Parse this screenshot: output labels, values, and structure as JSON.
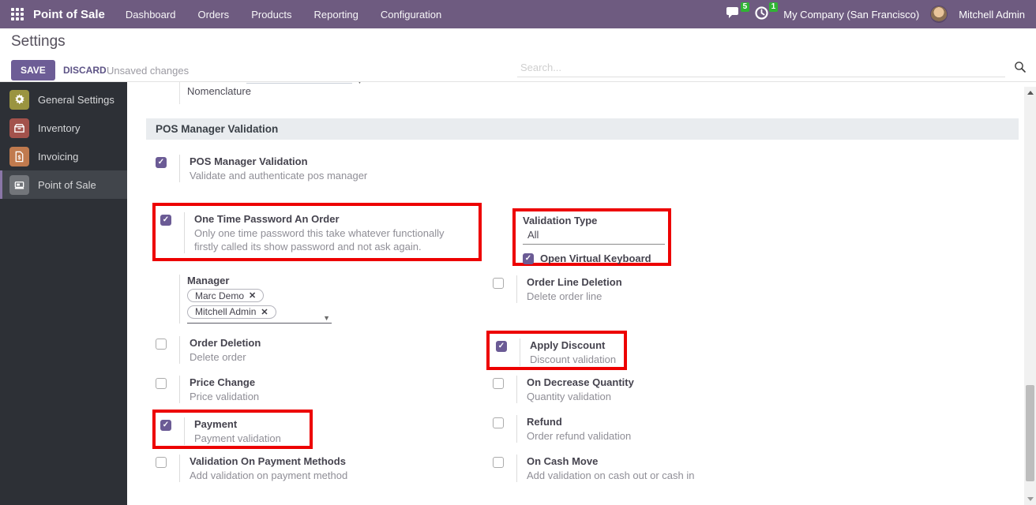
{
  "topbar": {
    "app_name": "Point of Sale",
    "menus": {
      "dashboard": "Dashboard",
      "orders": "Orders",
      "products": "Products",
      "reporting": "Reporting",
      "configuration": "Configuration"
    },
    "messages_badge": "5",
    "activities_badge": "1",
    "company": "My Company (San Francisco)",
    "user": "Mitchell Admin"
  },
  "control_panel": {
    "title": "Settings",
    "save_label": "SAVE",
    "discard_label": "DISCARD",
    "status": "Unsaved changes",
    "search_placeholder": "Search..."
  },
  "sidebar": {
    "items": {
      "general_settings": {
        "label": "General Settings",
        "icon": "gear-icon",
        "color": "#9a9440",
        "active": false
      },
      "inventory": {
        "label": "Inventory",
        "icon": "inventory-box-icon",
        "color": "#a3524c",
        "active": false
      },
      "invoicing": {
        "label": "Invoicing",
        "icon": "invoice-icon",
        "color": "#c07a4e",
        "active": false
      },
      "point_of_sale": {
        "label": "Point of Sale",
        "icon": "pos-register-icon",
        "color": "#72757a",
        "active": true
      }
    }
  },
  "content": {
    "nomenclature_label": "Nomenclature",
    "section_title": "POS Manager Validation",
    "settings": {
      "pos_manager_validation": {
        "label": "POS Manager Validation",
        "description": "Validate and authenticate pos manager",
        "checked": true,
        "highlighted": false
      },
      "one_time_password": {
        "label": "One Time Password An Order",
        "description": "Only one time password this take whatever functionally firstly called its show password and not ask again.",
        "checked": true,
        "highlighted": true
      },
      "order_line_deletion": {
        "label": "Order Line Deletion",
        "description": "Delete order line",
        "checked": false,
        "highlighted": false
      },
      "order_deletion": {
        "label": "Order Deletion",
        "description": "Delete order",
        "checked": false,
        "highlighted": false
      },
      "apply_discount": {
        "label": "Apply Discount",
        "description": "Discount validation",
        "checked": true,
        "highlighted": true
      },
      "price_change": {
        "label": "Price Change",
        "description": "Price validation",
        "checked": false,
        "highlighted": false
      },
      "on_decrease_quantity": {
        "label": "On Decrease Quantity",
        "description": "Quantity validation",
        "checked": false,
        "highlighted": false
      },
      "payment": {
        "label": "Payment",
        "description": "Payment validation",
        "checked": true,
        "highlighted": true
      },
      "refund": {
        "label": "Refund",
        "description": "Order refund validation",
        "checked": false,
        "highlighted": false
      },
      "validation_on_payment_methods": {
        "label": "Validation On Payment Methods",
        "description": "Add validation on payment method",
        "checked": false,
        "highlighted": false
      },
      "on_cash_move": {
        "label": "On Cash Move",
        "description": "Add validation on cash out or cash in",
        "checked": false,
        "highlighted": false
      }
    },
    "validation_type": {
      "label": "Validation Type",
      "value": "All",
      "keyboard_label": "Open Virtual Keyboard",
      "keyboard_checked": true,
      "highlighted": true
    },
    "manager": {
      "label": "Manager",
      "tags": {
        "0": "Marc Demo",
        "1": "Mitchell Admin"
      },
      "remove_glyph": "✕"
    }
  },
  "colors": {
    "topbar": "#6e5b80",
    "accent": "#6b5b95",
    "highlight_red": "#ed0000",
    "badge_green": "#30b434"
  }
}
